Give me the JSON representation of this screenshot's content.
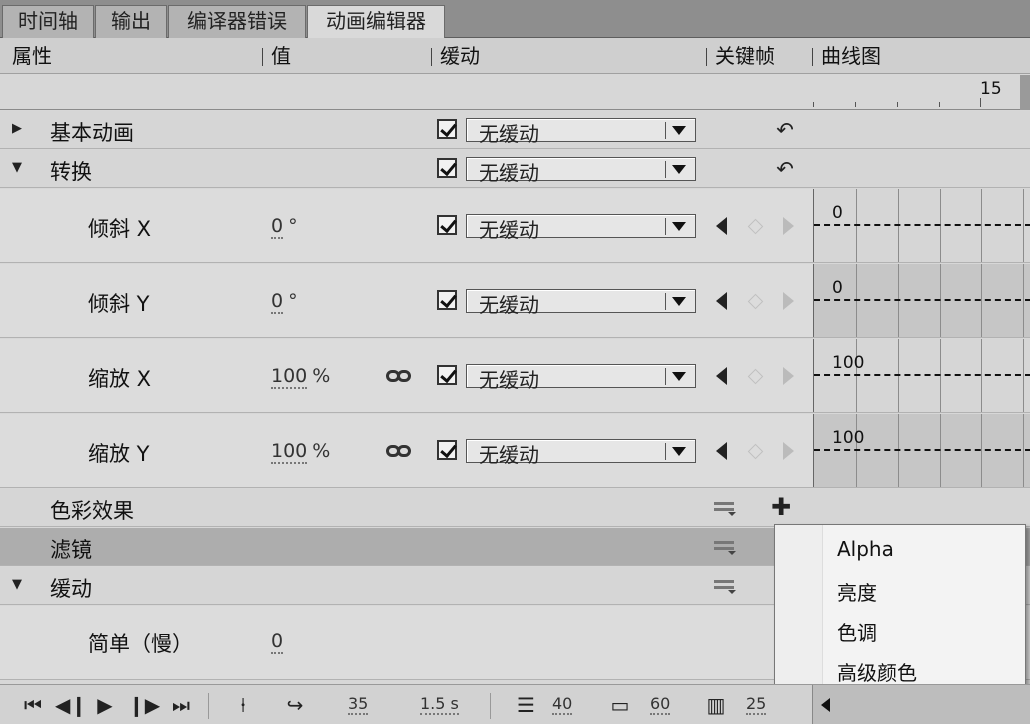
{
  "tabs": [
    {
      "label": "时间轴"
    },
    {
      "label": "输出"
    },
    {
      "label": "编译器错误"
    },
    {
      "label": "动画编辑器"
    }
  ],
  "columns": {
    "property": "属性",
    "value": "值",
    "ease": "缓动",
    "keyframe": "关键帧",
    "graph": "曲线图"
  },
  "ruler": {
    "label": "15"
  },
  "ease_default": "无缓动",
  "rows": {
    "basic_motion": {
      "label": "基本动画"
    },
    "transform": {
      "label": "转换"
    },
    "skew_x": {
      "label": "倾斜 X",
      "value": "0",
      "unit": "°",
      "graph_value": "0"
    },
    "skew_y": {
      "label": "倾斜 Y",
      "value": "0",
      "unit": "°",
      "graph_value": "0"
    },
    "scale_x": {
      "label": "缩放 X",
      "value": "100",
      "unit": "%",
      "graph_value": "100"
    },
    "scale_y": {
      "label": "缩放 Y",
      "value": "100",
      "unit": "%",
      "graph_value": "100"
    },
    "color_effect": {
      "label": "色彩效果"
    },
    "filters": {
      "label": "滤镜"
    },
    "eases": {
      "label": "缓动"
    },
    "simple_slow": {
      "label": "简单（慢）",
      "value": "0"
    }
  },
  "popup_menu": {
    "items": [
      {
        "label": "Alpha"
      },
      {
        "label": "亮度"
      },
      {
        "label": "色调"
      },
      {
        "label": "高级颜色"
      }
    ]
  },
  "toolbar": {
    "current_frame": "35",
    "duration": "1.5 s",
    "graph_size": "40",
    "expanded_graph_size": "60",
    "viewable_frames": "25"
  }
}
